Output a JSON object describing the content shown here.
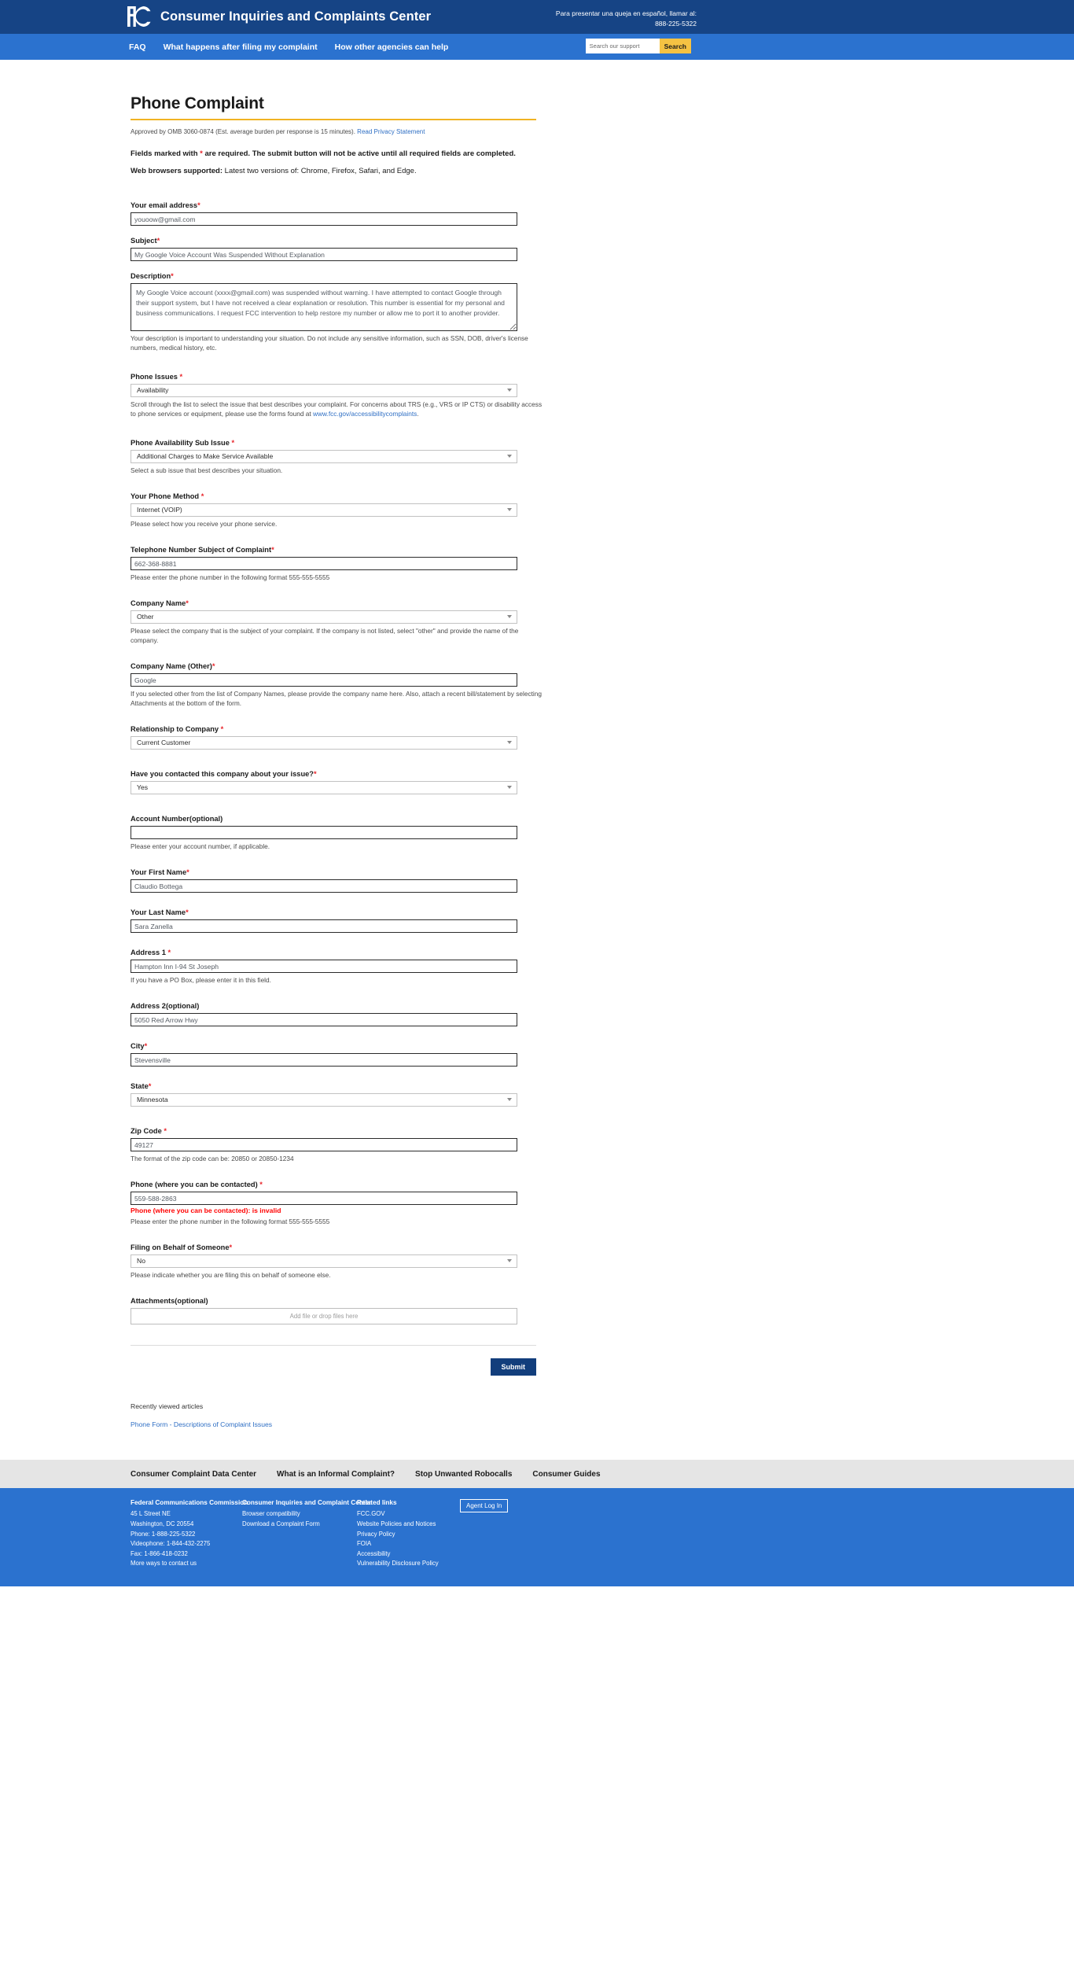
{
  "header": {
    "brand_title": "Consumer Inquiries and Complaints Center",
    "logo_name": "fcc-logo",
    "spanish_line1": "Para presentar una queja en español, llamar al:",
    "spanish_phone": "888-225-5322"
  },
  "nav": {
    "links": [
      "FAQ",
      "What happens after filing my complaint",
      "How other agencies can help"
    ],
    "search_placeholder": "Search our support",
    "search_button": "Search"
  },
  "main": {
    "title": "Phone Complaint",
    "omb_text": "Approved by OMB 3060-0874 (Est. average burden per response is 15 minutes).",
    "omb_link": "Read Privacy Statement",
    "notice_required_pre": "Fields marked with ",
    "notice_required_star": "*",
    "notice_required_post": " are required. The submit button will not be active until all required fields are completed.",
    "notice_browsers_bold": "Web browsers supported:",
    "notice_browsers_rest": " Latest two versions of: Chrome, Firefox, Safari, and Edge."
  },
  "fields": {
    "email": {
      "label": "Your email address",
      "required": true,
      "value": "youoow@gmail.com"
    },
    "subject": {
      "label": "Subject",
      "required": true,
      "value": "My Google Voice Account Was Suspended Without Explanation"
    },
    "description": {
      "label": "Description",
      "required": true,
      "value": "My Google Voice account (xxxx@gmail.com) was suspended without warning. I have attempted to contact Google through their support system, but I have not received a clear explanation or resolution. This number is essential for my personal and business communications. I request FCC intervention to help restore my number or allow me to port it to another provider.",
      "helper": "Your description is important to understanding your situation. Do not include any sensitive information, such as SSN, DOB, driver's license numbers, medical history, etc."
    },
    "phone_issues": {
      "label": "Phone Issues",
      "required": true,
      "value": "Availability",
      "helper_pre": "Scroll through the list to select the issue that best describes your complaint. For concerns about TRS (e.g., VRS or IP CTS) or disability access to phone services or equipment, please use the forms found at ",
      "helper_link": "www.fcc.gov/accessibilitycomplaints",
      "helper_post": "."
    },
    "sub_issue": {
      "label": "Phone Availability Sub Issue",
      "required": true,
      "value": "Additional Charges to Make Service Available",
      "helper": "Select a sub issue that best describes your situation."
    },
    "phone_method": {
      "label": "Your Phone Method",
      "required": true,
      "value": "Internet (VOIP)",
      "helper": "Please select how you receive your phone service."
    },
    "telephone_subject": {
      "label": "Telephone Number Subject of Complaint",
      "required": true,
      "value": "662-368-8881",
      "helper": "Please enter the phone number in the following format 555-555-5555"
    },
    "company_name": {
      "label": "Company Name",
      "required": true,
      "value": "Other",
      "helper": "Please select the company that is the subject of your complaint. If the company is not listed, select \"other\" and provide the name of the company."
    },
    "company_other": {
      "label": "Company Name (Other)",
      "required": true,
      "value": "Google",
      "helper": "If you selected other from the list of Company Names, please provide the company name here. Also, attach a recent bill/statement by selecting Attachments at the bottom of the form."
    },
    "relationship": {
      "label": "Relationship to Company",
      "required": true,
      "value": "Current Customer"
    },
    "contacted": {
      "label": "Have you contacted this company about your issue?",
      "required": true,
      "value": "Yes"
    },
    "account_number": {
      "label": "Account Number(optional)",
      "required": false,
      "value": "",
      "helper": "Please enter your account number, if applicable."
    },
    "first_name": {
      "label": "Your First Name",
      "required": true,
      "value": "Claudio Bottega"
    },
    "last_name": {
      "label": "Your Last Name",
      "required": true,
      "value": "Sara Zanella"
    },
    "address1": {
      "label": "Address 1",
      "required": true,
      "value": "Hampton Inn I-94 St Joseph",
      "helper": "If you have a PO Box, please enter it in this field."
    },
    "address2": {
      "label": "Address 2(optional)",
      "required": false,
      "value": "5050 Red Arrow Hwy"
    },
    "city": {
      "label": "City",
      "required": true,
      "value": "Stevensville"
    },
    "state": {
      "label": "State",
      "required": true,
      "value": "Minnesota"
    },
    "zip": {
      "label": "Zip Code",
      "required": true,
      "value": "49127",
      "helper": "The format of the zip code can be: 20850 or 20850-1234"
    },
    "contact_phone": {
      "label": "Phone (where you can be contacted)",
      "required": true,
      "value": "559-588-2863",
      "error": "Phone (where you can be contacted): is invalid",
      "helper": "Please enter the phone number in the following format 555-555-5555"
    },
    "behalf": {
      "label": "Filing on Behalf of Someone",
      "required": true,
      "value": "No",
      "helper": "Please indicate whether you are filing this on behalf of someone else."
    },
    "attachments": {
      "label": "Attachments(optional)",
      "required": false,
      "dropzone_text": "Add file or drop files here"
    }
  },
  "submit": {
    "label": "Submit"
  },
  "recent": {
    "title": "Recently viewed articles",
    "link": "Phone Form - Descriptions of Complaint Issues"
  },
  "footer": {
    "top_links": [
      "Consumer Complaint Data Center",
      "What is an Informal Complaint?",
      "Stop Unwanted Robocalls",
      "Consumer Guides"
    ],
    "col1": {
      "head": "Federal Communications Commission",
      "items": [
        "45 L Street NE",
        "Washington, DC 20554",
        "Phone: 1-888-225-5322",
        "Videophone: 1-844-432-2275",
        "Fax: 1-866-418-0232",
        "More ways to contact us"
      ]
    },
    "col2": {
      "head": "Consumer Inquiries and Complaint Center",
      "items": [
        "Browser compatibility",
        "Download a Complaint Form"
      ]
    },
    "col3": {
      "head": "Related links",
      "items": [
        "FCC.GOV",
        "Website Policies and Notices",
        "Privacy Policy",
        "FOIA",
        "Accessibility",
        "Vulnerability Disclosure Policy"
      ]
    },
    "agent_login": "Agent Log In"
  },
  "colors": {
    "header_blue": "#164485",
    "nav_blue": "#2b72cf",
    "accent_yellow": "#f0b323",
    "search_yellow": "#f5c243",
    "required_red": "#e8242a",
    "error_red": "#ff0000",
    "link_blue": "#2f6fc4",
    "submit_blue": "#123e7c"
  }
}
